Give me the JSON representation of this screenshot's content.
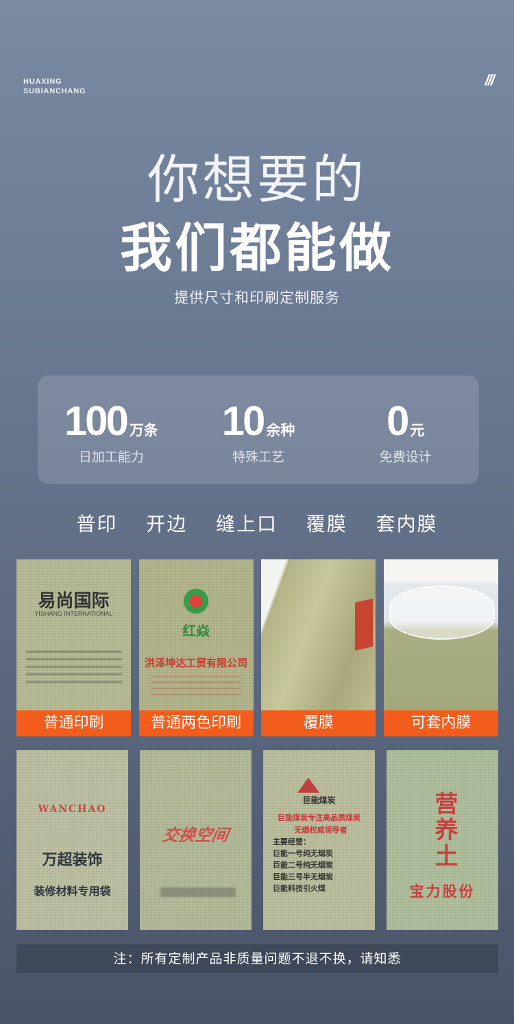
{
  "brand": {
    "line1": "HUAXING",
    "line2": "SUBIANCHANG",
    "mark": "///"
  },
  "hero": {
    "line1": "你想要的",
    "line2": "我们都能做",
    "subtitle": "提供尺寸和印刷定制服务"
  },
  "stats": [
    {
      "value": "100",
      "unit": "万条",
      "label": "日加工能力"
    },
    {
      "value": "10",
      "unit": "余种",
      "label": "特殊工艺"
    },
    {
      "value": "0",
      "unit": "元",
      "label": "免费设计"
    }
  ],
  "features": "普印  开边  缝上口  覆膜  套内膜",
  "cards_row1": [
    {
      "caption": "普通印刷",
      "print_title": "易尚国际",
      "print_sub": "YISHANG INTERNATIONAL"
    },
    {
      "caption": "普通两色印刷",
      "print_title": "红焱",
      "print_sub": "洪泽坤达工贸有限公司"
    },
    {
      "caption": "覆膜"
    },
    {
      "caption": "可套内膜"
    }
  ],
  "cards_row2": [
    {
      "print_logo": "WANCHAO",
      "print_title": "万超装饰",
      "print_sub": "装修材料专用袋"
    },
    {
      "print_title": "交换空间"
    },
    {
      "print_title": "巨能煤炭",
      "print_sub": "巨能煤炭专注高品质煤炭",
      "print_lines": [
        "无烟权威领导者",
        "主要经营：",
        "巨能一号纯无烟炭",
        "巨能二号纯无烟炭",
        "巨能三号半无烟炭",
        "巨能科技引火煤"
      ]
    },
    {
      "print_title": "营养土",
      "print_sub": "宝力股份"
    }
  ],
  "note": "注：所有定制产品非质量问题不退不换，请知悉",
  "colors": {
    "accent": "#f25c1c",
    "bg_top": "#7a8aa3",
    "bg_bottom": "#4a5468"
  }
}
